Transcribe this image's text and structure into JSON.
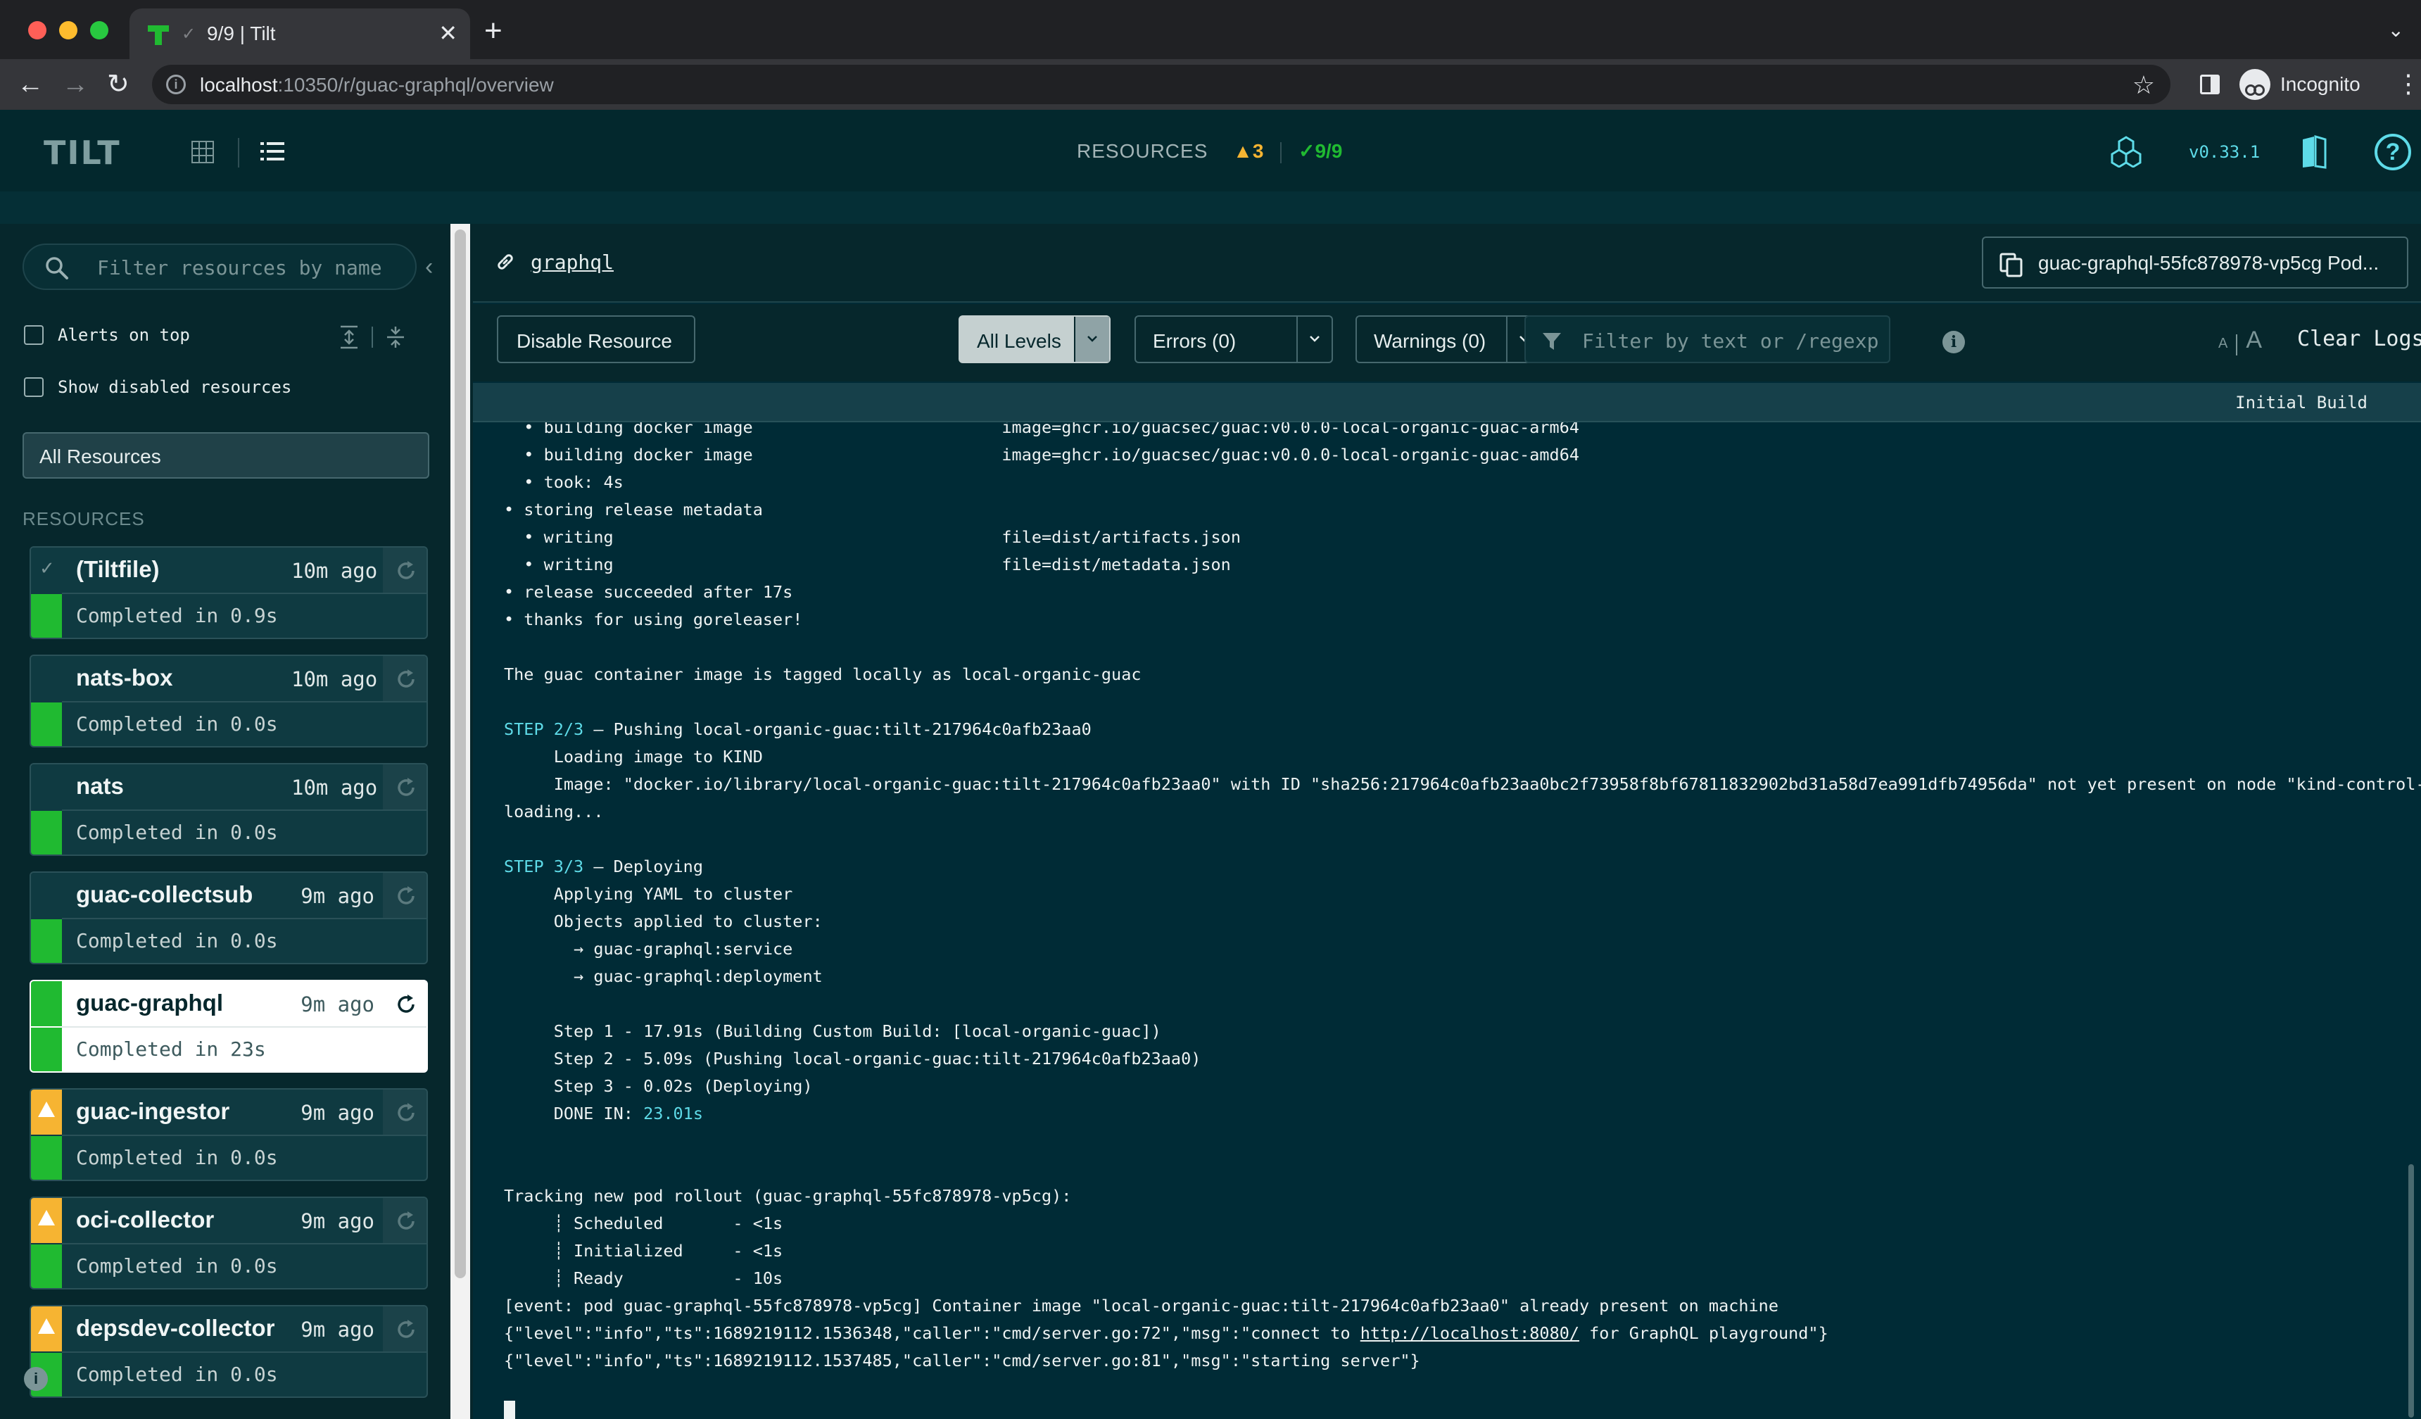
{
  "browser": {
    "tab_title": "9/9  |  Tilt",
    "url_host": "localhost",
    "url_path": ":10350/r/guac-graphql/overview",
    "profile_label": "Incognito"
  },
  "header": {
    "logo": "TILT",
    "resources_label": "RESOURCES",
    "warn_count": "▲3",
    "ok_count": "✓9/9",
    "version": "v0.33.1"
  },
  "sidebar": {
    "filter_placeholder": "Filter resources by name",
    "alerts_on_top": "Alerts on top",
    "show_disabled": "Show disabled resources",
    "all_resources": "All Resources",
    "resources_heading": "RESOURCES",
    "items": [
      {
        "name": "(Tiltfile)",
        "ago": "10m ago",
        "build": "Completed in 0.9s",
        "status": "ok-check"
      },
      {
        "name": "nats-box",
        "ago": "10m ago",
        "build": "Completed in 0.0s",
        "status": "ok"
      },
      {
        "name": "nats",
        "ago": "10m ago",
        "build": "Completed in 0.0s",
        "status": "ok"
      },
      {
        "name": "guac-collectsub",
        "ago": "9m ago",
        "build": "Completed in 0.0s",
        "status": "ok"
      },
      {
        "name": "guac-graphql",
        "ago": "9m ago",
        "build": "Completed in 23s",
        "status": "selected"
      },
      {
        "name": "guac-ingestor",
        "ago": "9m ago",
        "build": "Completed in 0.0s",
        "status": "warn"
      },
      {
        "name": "oci-collector",
        "ago": "9m ago",
        "build": "Completed in 0.0s",
        "status": "warn"
      },
      {
        "name": "depsdev-collector",
        "ago": "9m ago",
        "build": "Completed in 0.0s",
        "status": "warn"
      }
    ]
  },
  "main": {
    "resource_link": "graphql",
    "pod_button": "guac-graphql-55fc878978-vp5cg Pod...",
    "disable_button": "Disable Resource",
    "all_levels": "All Levels",
    "errors": "Errors (0)",
    "warnings": "Warnings (0)",
    "log_filter_placeholder": "Filter by text or /regexp/",
    "font_small": "A",
    "font_big": "A",
    "clear_logs": "Clear Logs",
    "section": "Initial Build"
  },
  "logs": [
    {
      "t": "  • building docker image                         image=ghcr.io/guacsec/guac:v0.0.0-local-organic-guac-arm64"
    },
    {
      "t": "  • building docker image                         image=ghcr.io/guacsec/guac:v0.0.0-local-organic-guac-amd64"
    },
    {
      "t": "  • took: 4s"
    },
    {
      "t": "• storing release metadata"
    },
    {
      "t": "  • writing                                       file=dist/artifacts.json"
    },
    {
      "t": "  • writing                                       file=dist/metadata.json"
    },
    {
      "t": "• release succeeded after 17s"
    },
    {
      "t": "• thanks for using goreleaser!"
    },
    {
      "t": ""
    },
    {
      "t": "The guac container image is tagged locally as local-organic-guac"
    },
    {
      "t": ""
    },
    {
      "step": "STEP 2/3",
      "t": " — Pushing local-organic-guac:tilt-217964c0afb23aa0"
    },
    {
      "t": "     Loading image to KIND"
    },
    {
      "t": "     Image: \"docker.io/library/local-organic-guac:tilt-217964c0afb23aa0\" with ID \"sha256:217964c0afb23aa0bc2f73958f8bf67811832902bd31a58d7ea991dfb74956da\" not yet present on node \"kind-control-plane\","
    },
    {
      "t": "loading..."
    },
    {
      "t": ""
    },
    {
      "step": "STEP 3/3",
      "t": " — Deploying"
    },
    {
      "t": "     Applying YAML to cluster"
    },
    {
      "t": "     Objects applied to cluster:"
    },
    {
      "t": "       → guac-graphql:service"
    },
    {
      "t": "       → guac-graphql:deployment"
    },
    {
      "t": ""
    },
    {
      "t": "     Step 1 - 17.91s (Building Custom Build: [local-organic-guac])"
    },
    {
      "t": "     Step 2 - 5.09s (Pushing local-organic-guac:tilt-217964c0afb23aa0)"
    },
    {
      "t": "     Step 3 - 0.02s (Deploying)"
    },
    {
      "t": "     DONE IN: ",
      "hl": "23.01s"
    },
    {
      "t": ""
    },
    {
      "t": ""
    },
    {
      "t": "Tracking new pod rollout (guac-graphql-55fc878978-vp5cg):"
    },
    {
      "t": "     ┊ Scheduled       - <1s"
    },
    {
      "t": "     ┊ Initialized     - <1s"
    },
    {
      "t": "     ┊ Ready           - 10s"
    },
    {
      "t": "[event: pod guac-graphql-55fc878978-vp5cg] Container image \"local-organic-guac:tilt-217964c0afb23aa0\" already present on machine"
    },
    {
      "t": "{\"level\":\"info\",\"ts\":1689219112.1536348,\"caller\":\"cmd/server.go:72\",\"msg\":\"connect to ",
      "lnk": "http://localhost:8080/",
      "tail": " for GraphQL playground\"}"
    },
    {
      "t": "{\"level\":\"info\",\"ts\":1689219112.1537485,\"caller\":\"cmd/server.go:81\",\"msg\":\"starting server\"}"
    }
  ]
}
